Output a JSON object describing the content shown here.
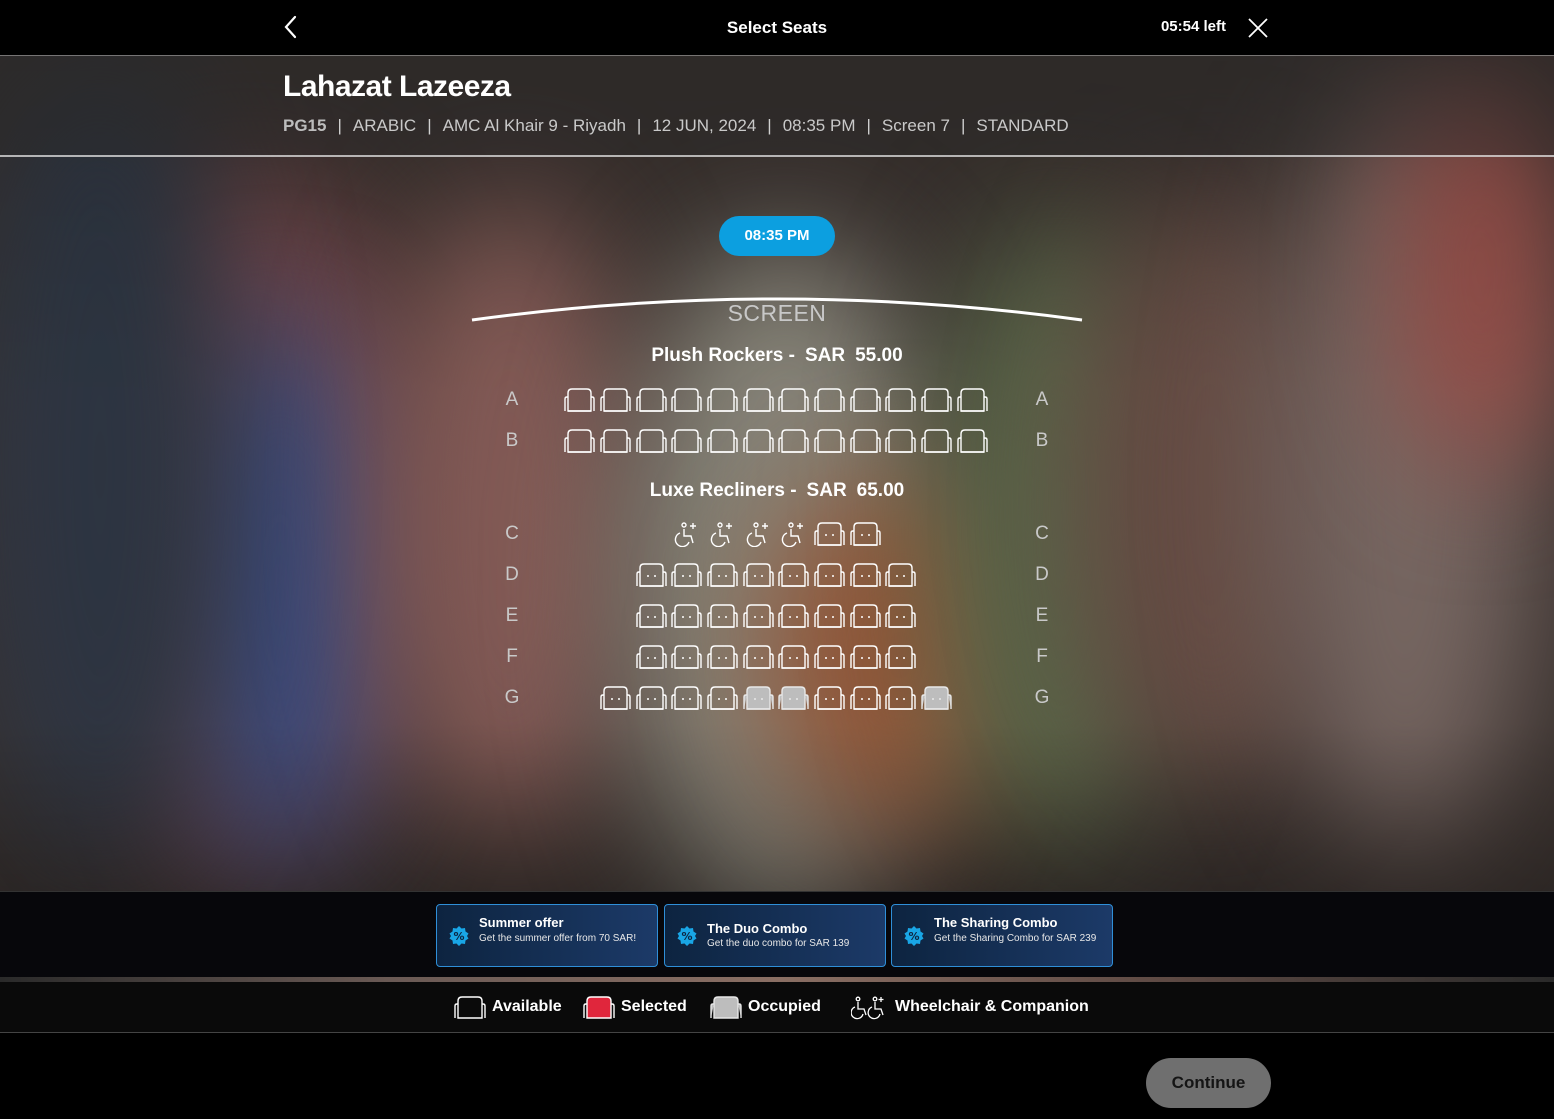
{
  "header": {
    "back_icon": "chevron-left-icon",
    "title": "Select Seats",
    "timer": "05:54 left",
    "close_icon": "close-x-icon"
  },
  "movie": {
    "title": "Lahazat Lazeeza",
    "rating": "PG15",
    "language": "ARABIC",
    "cinema": "AMC Al Khair 9 - Riyadh",
    "date": "12 JUN, 2024",
    "time": "08:35 PM",
    "screen": "Screen 7",
    "experience": "STANDARD"
  },
  "showtime": {
    "label": "08:35 PM"
  },
  "screen_label": "SCREEN",
  "sections": [
    {
      "name": "Plush Rockers -",
      "currency": "SAR",
      "price": "55.00",
      "rows": [
        {
          "label": "A",
          "seats": [
            "available",
            "available",
            "available",
            "available",
            "available",
            "available",
            "available",
            "available",
            "available",
            "available",
            "available",
            "available"
          ]
        },
        {
          "label": "B",
          "seats": [
            "available",
            "available",
            "available",
            "available",
            "available",
            "available",
            "available",
            "available",
            "available",
            "available",
            "available",
            "available"
          ]
        }
      ]
    },
    {
      "name": "Luxe Recliners -",
      "currency": "SAR",
      "price": "65.00",
      "rows": [
        {
          "label": "C",
          "seats": [
            "wheelchair",
            "wheelchair",
            "wheelchair",
            "wheelchair",
            "available",
            "available"
          ]
        },
        {
          "label": "D",
          "seats": [
            "available",
            "available",
            "available",
            "available",
            "available",
            "available",
            "available",
            "available"
          ]
        },
        {
          "label": "E",
          "seats": [
            "available",
            "available",
            "available",
            "available",
            "available",
            "available",
            "available",
            "available"
          ]
        },
        {
          "label": "F",
          "seats": [
            "available",
            "available",
            "available",
            "available",
            "available",
            "available",
            "available",
            "available"
          ]
        },
        {
          "label": "G",
          "seats": [
            "available",
            "available",
            "available",
            "available",
            "occupied",
            "occupied",
            "available",
            "available",
            "available",
            "occupied"
          ]
        }
      ]
    }
  ],
  "offers": [
    {
      "title": "Summer offer",
      "description": "Get the summer offer from 70 SAR!",
      "icon": "discount-percent-icon"
    },
    {
      "title": "The Duo Combo",
      "description": "Get the duo combo for SAR 139",
      "icon": "discount-percent-icon"
    },
    {
      "title": "The Sharing Combo",
      "description": "Get the Sharing Combo for SAR 239",
      "icon": "discount-percent-icon"
    }
  ],
  "legend": {
    "available": "Available",
    "selected": "Selected",
    "occupied": "Occupied",
    "wheelchair": "Wheelchair & Companion"
  },
  "colors": {
    "accent": "#0c9fe0",
    "selected": "#e0263c",
    "occupied": "#bdbdbd",
    "offer_border": "#2f8fd8",
    "continue_disabled": "#6f6f6f"
  },
  "continue_label": "Continue"
}
